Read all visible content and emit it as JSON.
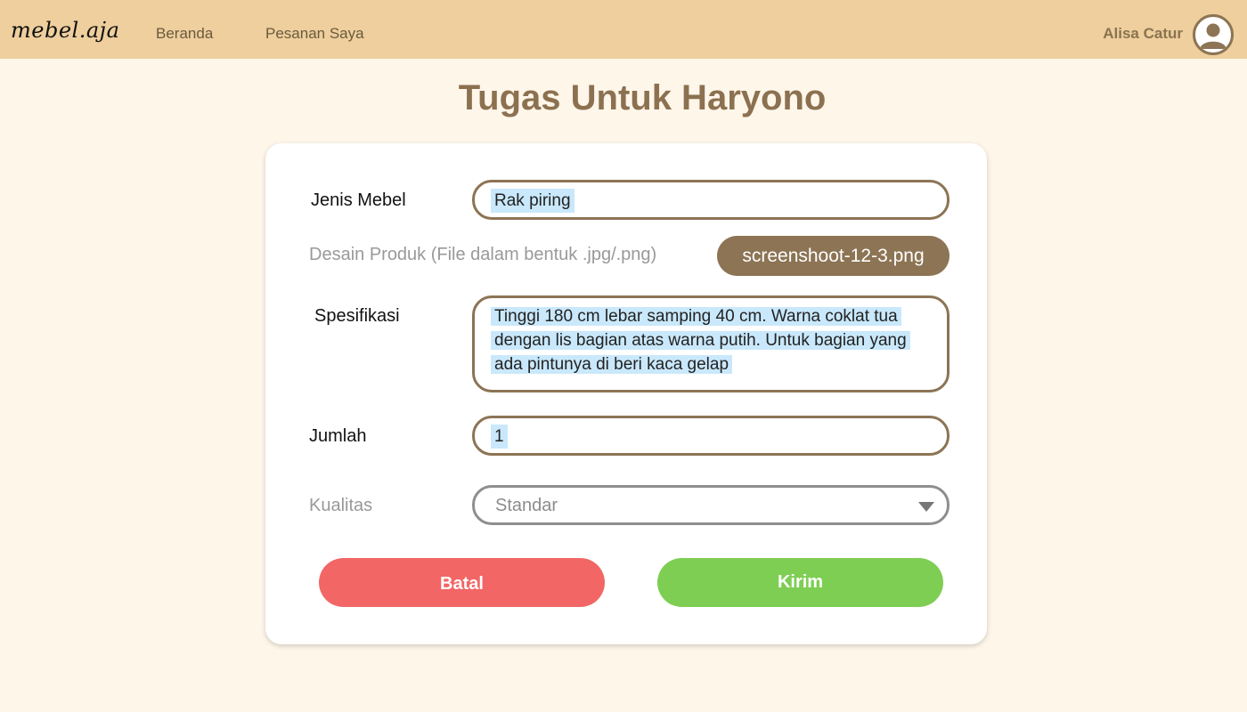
{
  "header": {
    "logo": "mebel.aja",
    "nav": [
      "Beranda",
      "Pesanan Saya"
    ],
    "user_name": "Alisa Catur"
  },
  "page": {
    "title": "Tugas Untuk Haryono"
  },
  "form": {
    "jenis_mebel": {
      "label": "Jenis Mebel",
      "value": "Rak piring"
    },
    "desain_produk": {
      "label": "Desain Produk (File dalam bentuk .jpg/.png)",
      "file_name": "screenshoot-12-3.png"
    },
    "spesifikasi": {
      "label": "Spesifikasi",
      "value": "Tinggi 180 cm lebar samping 40 cm. Warna coklat tua dengan lis bagian atas warna putih. Untuk bagian yang ada pintunya di beri kaca gelap"
    },
    "jumlah": {
      "label": "Jumlah",
      "value": "1"
    },
    "kualitas": {
      "label": "Kualitas",
      "value": "Standar"
    },
    "cancel_label": "Batal",
    "submit_label": "Kirim"
  },
  "colors": {
    "header_bg": "#eecf9d",
    "page_bg": "#fff6ea",
    "accent_brown": "#8c7454",
    "title_brown": "#8c7150",
    "cancel_red": "#f26666",
    "submit_green": "#7dce53",
    "selection_blue": "#c9e8fb"
  },
  "icons": {
    "avatar": "user-avatar-icon",
    "dropdown": "chevron-down-icon"
  }
}
